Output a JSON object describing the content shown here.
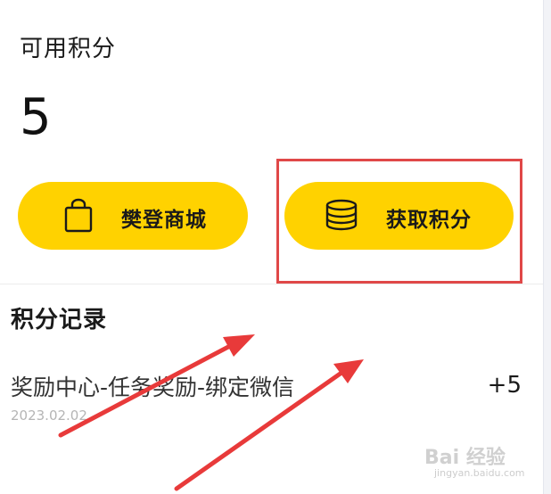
{
  "points": {
    "title": "可用积分",
    "value": "5"
  },
  "actions": {
    "mall_label": "樊登商城",
    "earn_label": "获取积分"
  },
  "records": {
    "title": "积分记录",
    "items": [
      {
        "description": "奖励中心-任务奖励-绑定微信",
        "date": "2023.02.02",
        "amount": "+5"
      }
    ]
  },
  "watermark": {
    "text": "Bai 经验",
    "sub": "jingyan.baidu.com"
  },
  "colors": {
    "button_yellow": "#ffd200",
    "highlight_red": "#e04848",
    "arrow_red": "#e83a3a"
  },
  "icons": {
    "mall": "shopping-bag-icon",
    "earn": "coin-stack-icon"
  }
}
